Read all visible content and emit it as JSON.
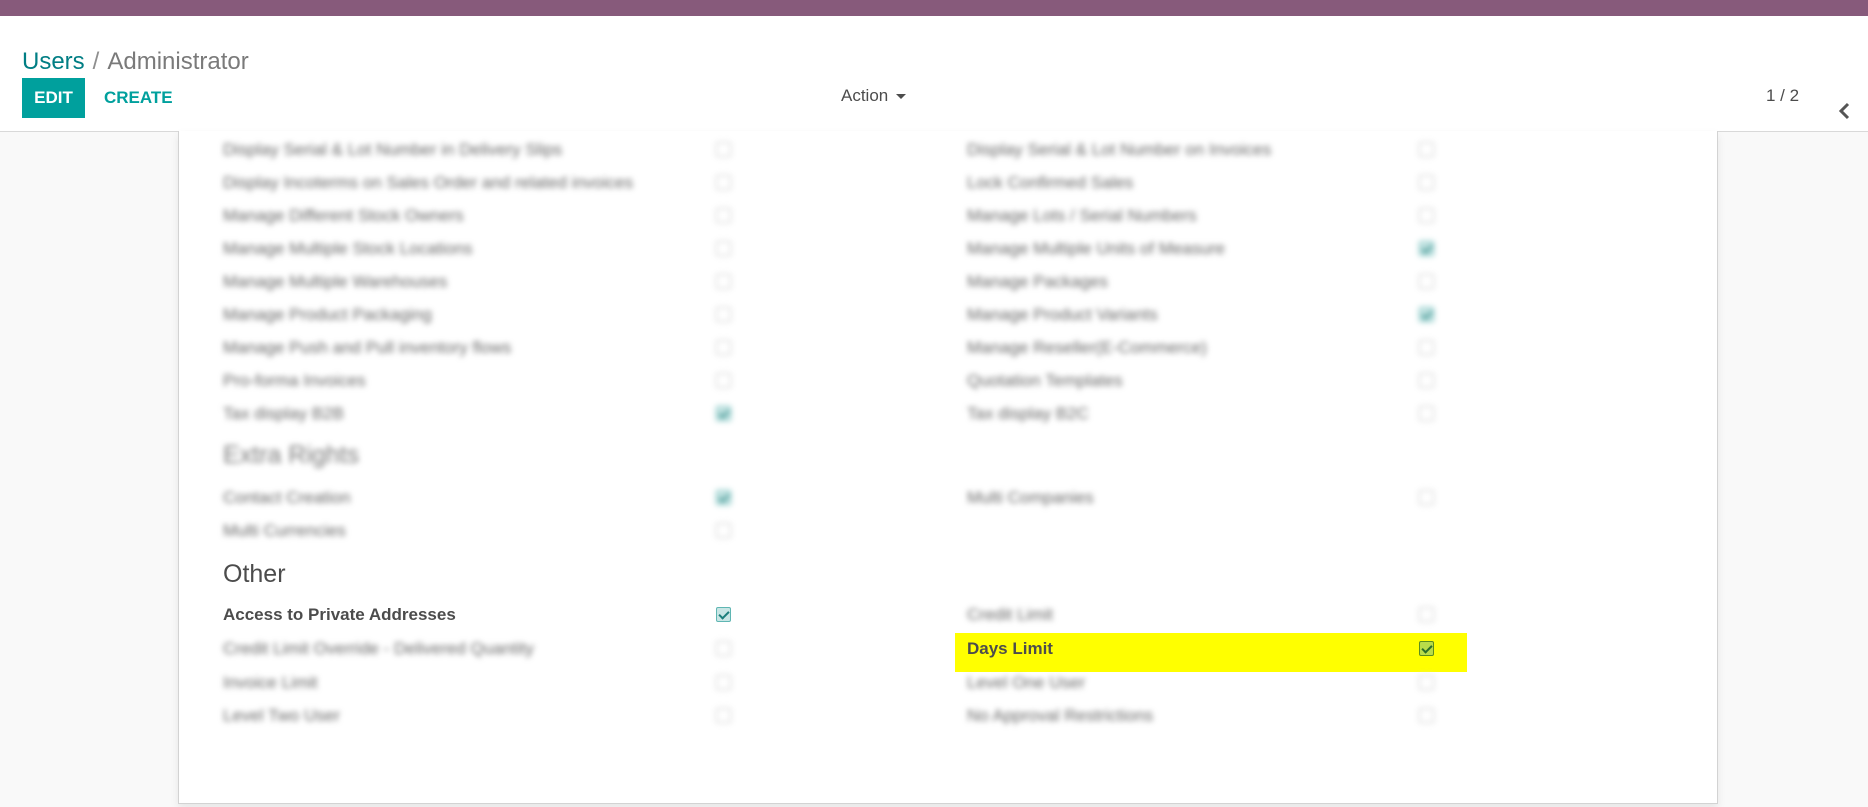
{
  "breadcrumb": {
    "parent": "Users",
    "separator": "/",
    "current": "Administrator"
  },
  "toolbar": {
    "edit_label": "EDIT",
    "create_label": "CREATE",
    "action_label": "Action"
  },
  "pager": {
    "value": "1 / 2"
  },
  "icons": {
    "previous": "chevron-left-icon",
    "action_caret": "caret-down-icon"
  },
  "colors": {
    "topbar": "#875a7b",
    "primary": "#00a09d",
    "link": "#017e84",
    "highlight": "#ffff00"
  },
  "sections": {
    "extra_rights_title": "Extra Rights",
    "other_title": "Other"
  },
  "blurred_rows": [
    {
      "left": "Display Serial & Lot Number in Delivery Slips",
      "left_checked": false,
      "right": "Display Serial & Lot Number on Invoices",
      "right_checked": false
    },
    {
      "left": "Display Incoterms on Sales Order and related invoices",
      "left_checked": false,
      "right": "Lock Confirmed Sales",
      "right_checked": false
    },
    {
      "left": "Manage Different Stock Owners",
      "left_checked": false,
      "right": "Manage Lots / Serial Numbers",
      "right_checked": false
    },
    {
      "left": "Manage Multiple Stock Locations",
      "left_checked": false,
      "right": "Manage Multiple Units of Measure",
      "right_checked": true
    },
    {
      "left": "Manage Multiple Warehouses",
      "left_checked": false,
      "right": "Manage Packages",
      "right_checked": false
    },
    {
      "left": "Manage Product Packaging",
      "left_checked": false,
      "right": "Manage Product Variants",
      "right_checked": true
    },
    {
      "left": "Manage Push and Pull inventory flows",
      "left_checked": false,
      "right": "Manage Reseller(E-Commerce)",
      "right_checked": false
    },
    {
      "left": "Pro-forma Invoices",
      "left_checked": false,
      "right": "Quotation Templates",
      "right_checked": false
    },
    {
      "left": "Tax display B2B",
      "left_checked": true,
      "right": "Tax display B2C",
      "right_checked": false
    }
  ],
  "extra_rights_rows": [
    {
      "left": "Contact Creation",
      "left_checked": true,
      "right": "Multi Companies",
      "right_checked": false
    },
    {
      "left": "Multi Currencies",
      "left_checked": false
    }
  ],
  "other_rows": [
    {
      "left": "Access to Private Addresses",
      "left_checked": true,
      "right": "Credit Limit",
      "right_checked": false
    },
    {
      "left": "Credit Limit Override - Delivered Quantity",
      "left_checked": false,
      "right": "Days Limit",
      "right_checked": true
    },
    {
      "left": "Invoice Limit",
      "left_checked": false,
      "right": "Level One User",
      "right_checked": false
    },
    {
      "left": "Level Two User",
      "left_checked": false,
      "right": "No Approval Restrictions",
      "right_checked": false
    }
  ]
}
